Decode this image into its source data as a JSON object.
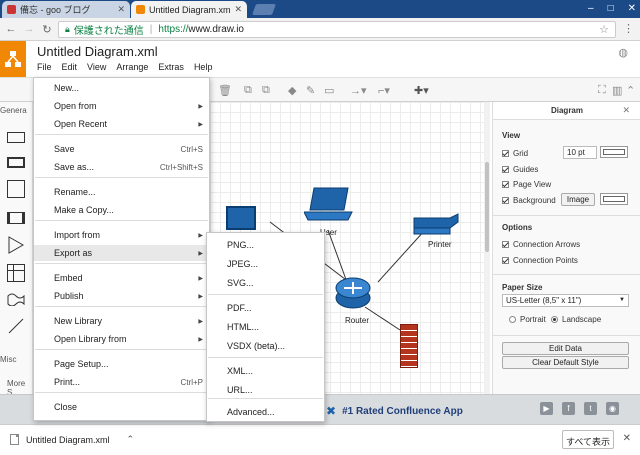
{
  "browser": {
    "tabs": [
      {
        "title": "備忘 - goo ブログ",
        "active": false,
        "favicon_color": "#cc3333"
      },
      {
        "title": "Untitled Diagram.xml",
        "active": true,
        "favicon_color": "#f08705"
      }
    ],
    "secure_label": "保護された通信",
    "url_separator": "|",
    "url_protocol": "https://",
    "url_host": "www.draw.io"
  },
  "app": {
    "title": "Untitled Diagram.xml",
    "menus": [
      "File",
      "Edit",
      "View",
      "Arrange",
      "Extras",
      "Help"
    ],
    "accent": "#f08705"
  },
  "left_panel": {
    "general_label": "Genera",
    "misc_label": "Misc",
    "more_label": "More S"
  },
  "file_menu": {
    "items": [
      {
        "label": "New...",
        "shortcut": "",
        "submenu": false,
        "highlighted": false
      },
      {
        "label": "Open from",
        "shortcut": "",
        "submenu": true,
        "highlighted": false
      },
      {
        "label": "Open Recent",
        "shortcut": "",
        "submenu": true,
        "highlighted": false
      },
      {
        "label": "Save",
        "shortcut": "Ctrl+S",
        "submenu": false,
        "highlighted": false
      },
      {
        "label": "Save as...",
        "shortcut": "Ctrl+Shift+S",
        "submenu": false,
        "highlighted": false
      },
      {
        "label": "Rename...",
        "shortcut": "",
        "submenu": false,
        "highlighted": false
      },
      {
        "label": "Make a Copy...",
        "shortcut": "",
        "submenu": false,
        "highlighted": false
      },
      {
        "label": "Import from",
        "shortcut": "",
        "submenu": true,
        "highlighted": false
      },
      {
        "label": "Export as",
        "shortcut": "",
        "submenu": true,
        "highlighted": true
      },
      {
        "label": "Embed",
        "shortcut": "",
        "submenu": true,
        "highlighted": false
      },
      {
        "label": "Publish",
        "shortcut": "",
        "submenu": true,
        "highlighted": false
      },
      {
        "label": "New Library",
        "shortcut": "",
        "submenu": true,
        "highlighted": false
      },
      {
        "label": "Open Library from",
        "shortcut": "",
        "submenu": true,
        "highlighted": false
      },
      {
        "label": "Page Setup...",
        "shortcut": "",
        "submenu": false,
        "highlighted": false
      },
      {
        "label": "Print...",
        "shortcut": "Ctrl+P",
        "submenu": false,
        "highlighted": false
      },
      {
        "label": "Close",
        "shortcut": "",
        "submenu": false,
        "highlighted": false
      }
    ]
  },
  "export_menu": {
    "items": [
      "PNG...",
      "JPEG...",
      "SVG...",
      "PDF...",
      "HTML...",
      "VSDX (beta)...",
      "XML...",
      "URL...",
      "Advanced..."
    ]
  },
  "diagram": {
    "labels": [
      "User",
      "Printer",
      "Router"
    ]
  },
  "format_panel": {
    "tab": "Diagram",
    "view_heading": "View",
    "grid_label": "Grid",
    "grid_size": "10 pt",
    "guides_label": "Guides",
    "page_view_label": "Page View",
    "background_label": "Background",
    "image_button": "Image",
    "options_heading": "Options",
    "connection_arrows": "Connection Arrows",
    "connection_points": "Connection Points",
    "paper_heading": "Paper Size",
    "paper_value": "US-Letter (8,5\" x 11\")",
    "portrait": "Portrait",
    "landscape": "Landscape",
    "edit_data": "Edit Data",
    "clear_style": "Clear Default Style"
  },
  "footer": {
    "confluence": "#1 Rated Confluence App"
  },
  "download_bar": {
    "file_name": "Untitled Diagram.xml",
    "show_all": "すべて表示"
  }
}
